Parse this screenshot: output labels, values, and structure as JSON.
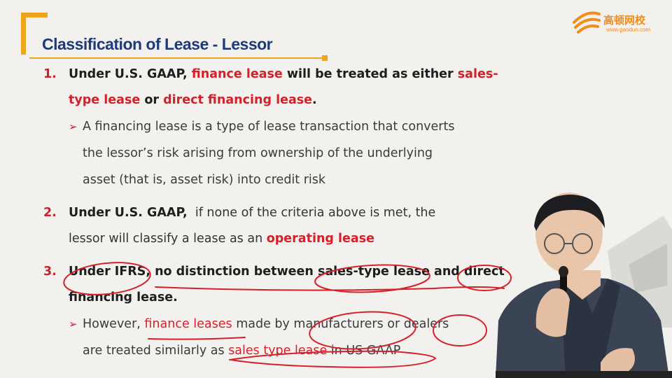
{
  "slide": {
    "title": "Classification of Lease - Lessor",
    "accent_color": "#f0a31e",
    "title_color": "#1f3a7a",
    "highlight_color": "#d5202a"
  },
  "logo": {
    "icon": "gaodun-logo-icon",
    "chinese_name": "高顿网校",
    "url": "www.gaodun.com"
  },
  "items": [
    {
      "number": "1.",
      "line1": {
        "a": "Under U.S. GAAP, ",
        "b": "finance lease",
        "c": " will be treated as either ",
        "d": "sales-"
      },
      "line2": {
        "a": "type lease",
        "b": " or ",
        "c": "direct financing lease",
        "d": "."
      },
      "sub": {
        "marker": "➢",
        "line1": "A financing lease is a type of lease transaction that converts",
        "line2": "the lessor’s risk arising from ownership of the underlying",
        "line3": "asset (that is, asset risk) into credit risk"
      }
    },
    {
      "number": "2.",
      "line1": {
        "a": "Under U.S. GAAP,",
        "b": "  if none of the criteria above is met, the"
      },
      "line2": {
        "a": "lessor will classify a lease as an ",
        "b": "operating lease"
      }
    },
    {
      "number": "3.",
      "line1": {
        "a": "Under IFRS,",
        "b": " no distinction between sales-type lease and direct"
      },
      "line2": {
        "a": "financing lease."
      },
      "sub": {
        "marker": "➢",
        "line1a": "However, ",
        "line1b": "finance leases",
        "line1c": " made by manufacturers or dealers",
        "line2a": "are treated similarly as ",
        "line2b": "sales type lease",
        "line2c": " in US GAAP"
      }
    }
  ],
  "presenter": {
    "icon": "presenter-figure-icon"
  }
}
